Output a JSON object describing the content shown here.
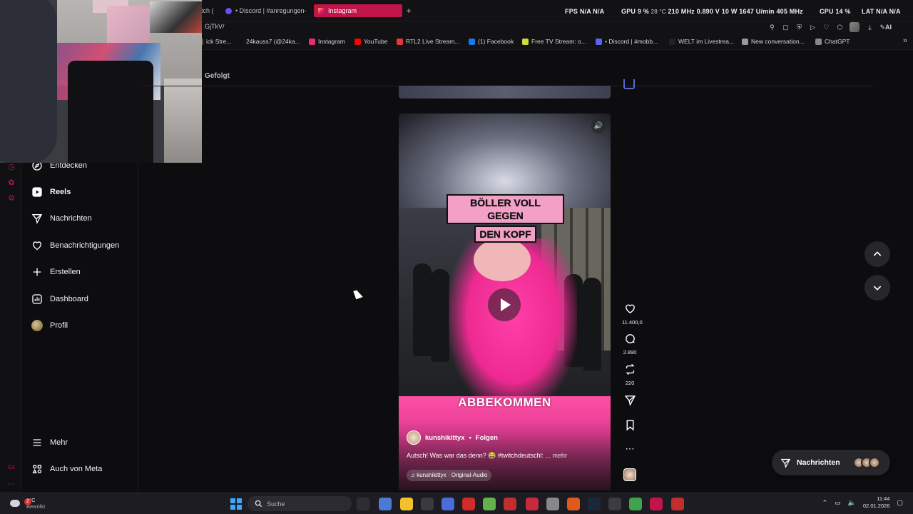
{
  "browser": {
    "tabs": [
      {
        "label": "tch ("
      },
      {
        "label": "• Discord | #anregungen-"
      },
      {
        "label": "Instagram"
      }
    ],
    "url": "GjTkV/",
    "hud": {
      "fps_label": "FPS",
      "fps_value1": "N/A",
      "fps_value2": "N/A",
      "gpu_label": "GPU",
      "gpu_load": "9 %",
      "gpu_temp": "28 °C",
      "gpu_clock": "210 MHz",
      "gpu_volt": "0.890 V",
      "gpu_power": "10 W",
      "gpu_fan": "1647 U/min",
      "gpu_mem": "405 MHz",
      "cpu_label": "CPU",
      "cpu_load": "14 %",
      "lat_label": "LAT",
      "lat_value1": "N/A",
      "lat_value2": "N/A"
    },
    "ai_label": "AI",
    "bookmarks": [
      {
        "label": "ick Stre...",
        "color": "#555"
      },
      {
        "label": "24kauss7 (@24ka...",
        "color": "#111"
      },
      {
        "label": "Instagram",
        "color": "#e1306c"
      },
      {
        "label": "YouTube",
        "color": "#ff0000"
      },
      {
        "label": "RTL2 Live Stream...",
        "color": "#e53935"
      },
      {
        "label": "(1) Facebook",
        "color": "#1877f2"
      },
      {
        "label": "Free TV Stream: o...",
        "color": "#cddc39"
      },
      {
        "label": "• Discord | #mobb...",
        "color": "#5865f2"
      },
      {
        "label": "WELT im Livestrea...",
        "color": "#222"
      },
      {
        "label": "New conversation...",
        "color": "#999"
      },
      {
        "label": "ChatGPT",
        "color": "#888"
      }
    ]
  },
  "sidebar": {
    "items": [
      {
        "label": "Entdecken",
        "icon": "compass-icon"
      },
      {
        "label": "Reels",
        "icon": "reels-icon"
      },
      {
        "label": "Nachrichten",
        "icon": "paper-plane-icon"
      },
      {
        "label": "Benachrichtigungen",
        "icon": "heart-icon"
      },
      {
        "label": "Erstellen",
        "icon": "plus-icon"
      },
      {
        "label": "Dashboard",
        "icon": "dashboard-icon"
      },
      {
        "label": "Profil",
        "icon": "profile-picture"
      }
    ],
    "bottom": [
      {
        "label": "Mehr",
        "icon": "menu-icon"
      },
      {
        "label": "Auch von Meta",
        "icon": "meta-apps-icon"
      }
    ]
  },
  "feed": {
    "following_label": "Gefolgt",
    "reel": {
      "caption_top_line1": "BÖLLER VOLL GEGEN",
      "caption_top_line2": "DEN KOPF",
      "caption_bottom": "ABBEKOMMEN",
      "author": "kunshikittyx",
      "separator": "•",
      "follow_label": "Folgen",
      "caption": "Autsch! Was war das denn? 😂 #twitchdeutschl:",
      "more_label": "... mehr",
      "audio": "kunshikittyx · Original-Audio"
    },
    "actions": {
      "likes": "11.400,0",
      "comments": "2.890",
      "reposts": "220"
    }
  },
  "messages_pill": {
    "label": "Nachrichten"
  },
  "taskbar": {
    "weather_badge": "2",
    "weather_temp": "2°C",
    "weather_desc": "Bewölkt",
    "search_placeholder": "Suche",
    "clock_time": "11:44",
    "clock_date": "02.01.2026"
  },
  "colors": {
    "accent": "#c2134a",
    "reel_pink": "#ee2a92",
    "background": "#0d0d0f"
  }
}
